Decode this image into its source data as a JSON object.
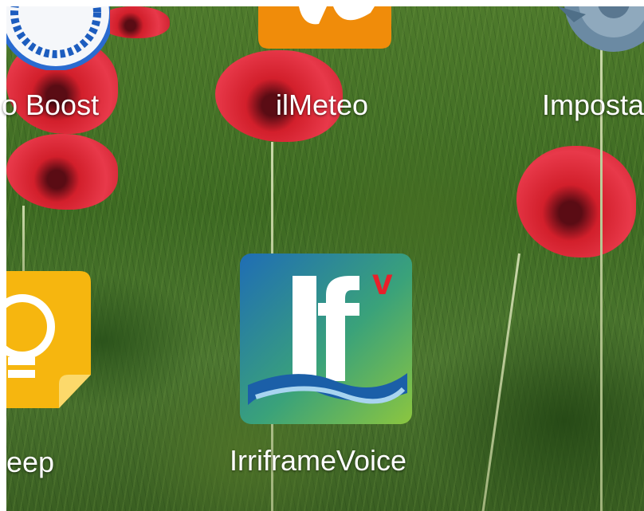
{
  "home_screen": {
    "apps": [
      {
        "name": "Boost",
        "label": "o Boost"
      },
      {
        "name": "ilMeteo",
        "label": "ilMeteo"
      },
      {
        "name": "Impostazioni",
        "label": "Imposta"
      },
      {
        "name": "Keep",
        "label": "eep"
      },
      {
        "name": "IrriframeVoice",
        "label": "IrriframeVoice",
        "badge": "If",
        "badge_sup": "v"
      }
    ]
  },
  "colors": {
    "meteo_orange": "#f08c0a",
    "keep_yellow": "#f6b60f",
    "irri_blue": "#1f6db5",
    "irri_green": "#7cc242",
    "irri_red": "#e8202a"
  }
}
